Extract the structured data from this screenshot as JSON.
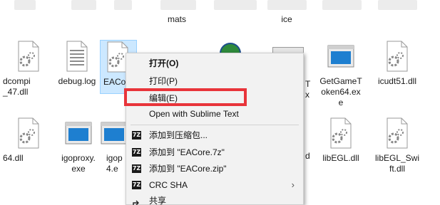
{
  "top_row": [
    {
      "label": "mats"
    },
    {
      "label": "ice"
    }
  ],
  "files": [
    {
      "label": "dcompi\n_47.dll",
      "icon": "dll-gear-icon"
    },
    {
      "label": "debug.log",
      "icon": "text-file-icon"
    },
    {
      "label": "EACo",
      "icon": "dll-gear-icon"
    },
    {
      "label": "GetGameT\noken64.ex\ne",
      "icon": "exe-window-icon"
    },
    {
      "label": "icudt51.dll",
      "icon": "dll-gear-icon"
    },
    {
      "label": "64.dll",
      "icon": "dll-gear-icon"
    },
    {
      "label": "igoproxy.\nexe",
      "icon": "exe-window-icon"
    },
    {
      "label": "igop\n4.e",
      "icon": "exe-window-icon"
    },
    {
      "label": "libEGL.dll",
      "icon": "dll-gear-icon"
    },
    {
      "label": "libEGL_Swi\nft.dll",
      "icon": "dll-gear-icon"
    }
  ],
  "partial_labels": {
    "t": "T",
    "x": "x",
    "d": "d"
  },
  "context_menu": {
    "open": "打开(O)",
    "print": "打印(P)",
    "edit": "编辑(E)",
    "sublime": "Open with Sublime Text",
    "add_archive": "添加到压缩包...",
    "add_7z": "添加到 \"EACore.7z\"",
    "add_zip": "添加到 \"EACore.zip\"",
    "crc": "CRC SHA",
    "share": "共享",
    "archive_icon_text": "7Z",
    "submenu_arrow": "›"
  },
  "colors": {
    "highlight_border": "#e8343a",
    "selection_bg": "#cce8ff",
    "exe_blue": "#1e7fd0"
  }
}
